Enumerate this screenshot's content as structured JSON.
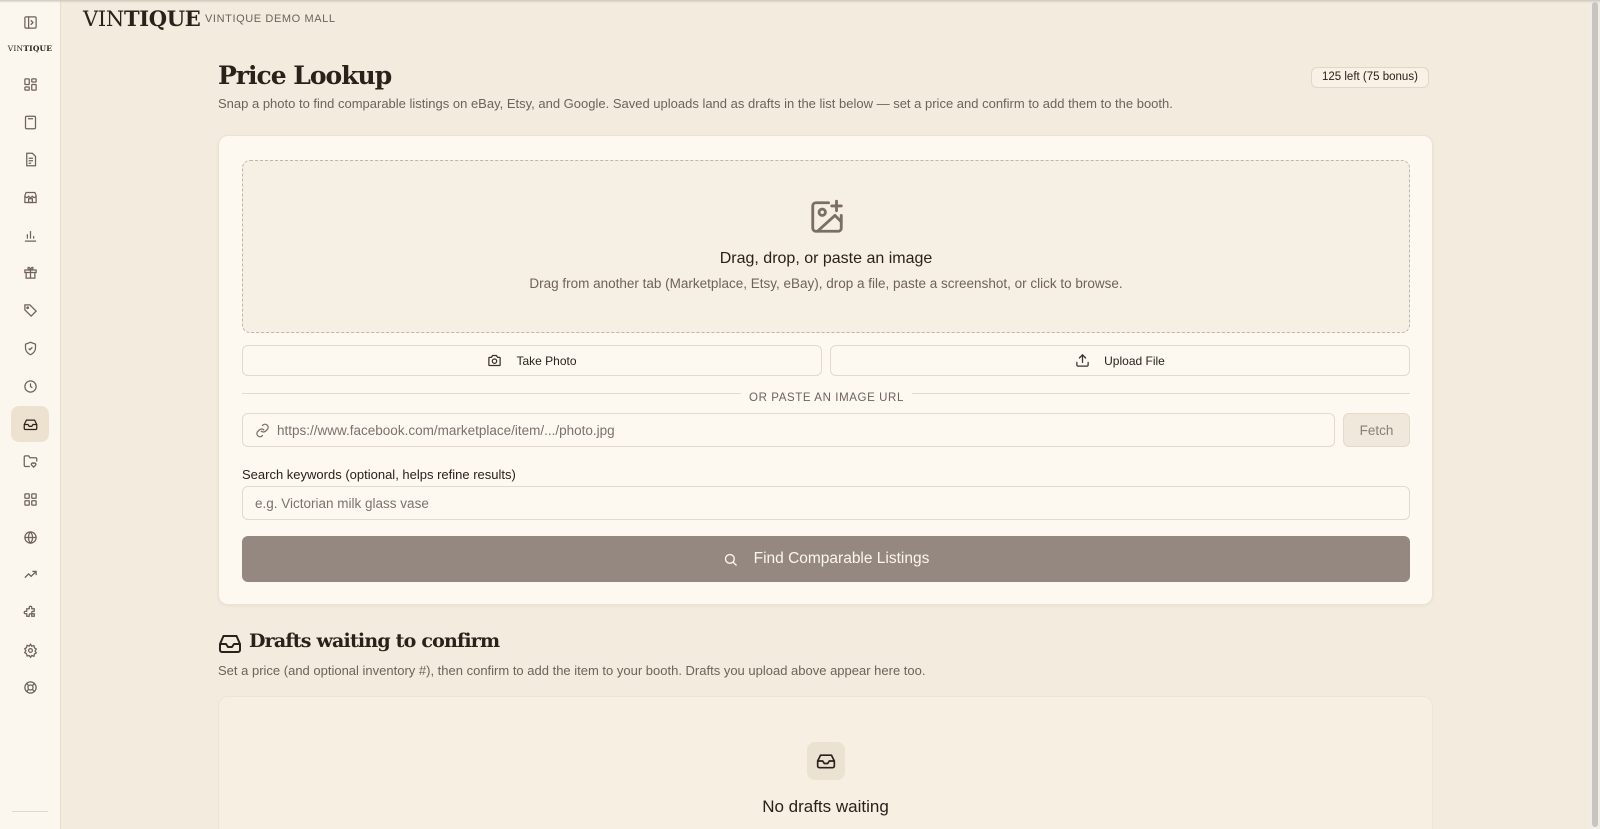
{
  "sidebar": {
    "logo_prefix": "VIN",
    "logo_suffix": "TIQUE",
    "items": [
      {
        "icon": "dashboard-icon"
      },
      {
        "icon": "calculator-icon"
      },
      {
        "icon": "document-icon"
      },
      {
        "icon": "store-icon"
      },
      {
        "icon": "bar-chart-icon"
      },
      {
        "icon": "gift-icon"
      },
      {
        "icon": "tag-icon"
      },
      {
        "icon": "shield-check-icon"
      },
      {
        "icon": "clock-icon"
      },
      {
        "icon": "inbox-icon",
        "active": true
      },
      {
        "icon": "folder-heart-icon"
      },
      {
        "icon": "grid-icon"
      },
      {
        "icon": "globe-icon"
      },
      {
        "icon": "trending-up-icon"
      },
      {
        "icon": "puzzle-icon"
      },
      {
        "icon": "settings-icon"
      },
      {
        "icon": "help-buoy-icon"
      }
    ]
  },
  "header": {
    "brand_prefix": "VIN",
    "brand_suffix": "TIQUE",
    "mall_name": "VINTIQUE DEMO MALL"
  },
  "page": {
    "title": "Price Lookup",
    "subtitle": "Snap a photo to find comparable listings on eBay, Etsy, and Google. Saved uploads land as drafts in the list below — set a price and confirm to add them to the booth.",
    "quota": "125 left (75 bonus)"
  },
  "upload": {
    "dropzone_title": "Drag, drop, or paste an image",
    "dropzone_subtitle": "Drag from another tab (Marketplace, Etsy, eBay), drop a file, paste a screenshot, or click to browse.",
    "take_photo_label": "Take Photo",
    "upload_file_label": "Upload File",
    "divider_label": "OR PASTE AN IMAGE URL",
    "url_placeholder": "https://www.facebook.com/marketplace/item/.../photo.jpg",
    "fetch_label": "Fetch",
    "keywords_label": "Search keywords (optional, helps refine results)",
    "keywords_placeholder": "e.g. Victorian milk glass vase",
    "find_label": "Find Comparable Listings"
  },
  "drafts": {
    "title": "Drafts waiting to confirm",
    "subtitle": "Set a price (and optional inventory #), then confirm to add the item to your booth. Drafts you upload above appear here too.",
    "empty_title": "No drafts waiting"
  },
  "colors": {
    "background": "#f3ebdd",
    "card": "#fdf9f0",
    "primary_button": "#958880",
    "text": "#2b201a",
    "muted_text": "#6e625a"
  }
}
